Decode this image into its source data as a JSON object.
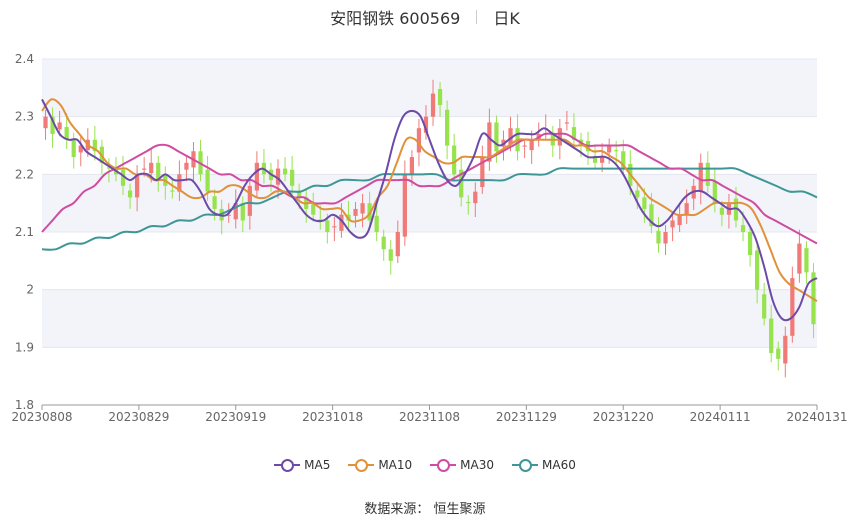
{
  "header": {
    "title": "安阳钢铁 600569",
    "period": "日K"
  },
  "source": "数据来源： 恒生聚源",
  "chart_data": {
    "type": "candlestick",
    "ylim": [
      1.8,
      2.4
    ],
    "yticks": [
      "1.8",
      "1.9",
      "2",
      "2.1",
      "2.2",
      "2.3",
      "2.4"
    ],
    "xticks": [
      "20230808",
      "20230829",
      "20230919",
      "20231018",
      "20231108",
      "20231129",
      "20231220",
      "20240111",
      "20240131"
    ],
    "colors": {
      "up": "#f07a78",
      "down": "#97e34e",
      "MA5": "#6c4aa8",
      "MA10": "#e0913a",
      "MA30": "#cf4ca0",
      "MA60": "#3f9696"
    },
    "legend": [
      {
        "name": "MA5",
        "color": "#6c4aa8"
      },
      {
        "name": "MA10",
        "color": "#e0913a"
      },
      {
        "name": "MA30",
        "color": "#cf4ca0"
      },
      {
        "name": "MA60",
        "color": "#3f9696"
      }
    ],
    "closes": [
      2.3,
      2.27,
      2.29,
      2.26,
      2.23,
      2.25,
      2.26,
      2.24,
      2.22,
      2.21,
      2.2,
      2.18,
      2.16,
      2.2,
      2.21,
      2.22,
      2.19,
      2.18,
      2.17,
      2.2,
      2.22,
      2.24,
      2.2,
      2.17,
      2.14,
      2.12,
      2.13,
      2.15,
      2.12,
      2.18,
      2.22,
      2.2,
      2.19,
      2.21,
      2.2,
      2.18,
      2.16,
      2.14,
      2.13,
      2.12,
      2.1,
      2.11,
      2.13,
      2.12,
      2.14,
      2.15,
      2.12,
      2.1,
      2.07,
      2.05,
      2.1,
      2.2,
      2.23,
      2.28,
      2.3,
      2.34,
      2.32,
      2.25,
      2.2,
      2.16,
      2.15,
      2.17,
      2.23,
      2.29,
      2.24,
      2.26,
      2.28,
      2.24,
      2.25,
      2.26,
      2.27,
      2.28,
      2.25,
      2.28,
      2.29,
      2.26,
      2.25,
      2.24,
      2.22,
      2.23,
      2.25,
      2.24,
      2.21,
      2.18,
      2.16,
      2.14,
      2.11,
      2.08,
      2.1,
      2.12,
      2.13,
      2.15,
      2.18,
      2.22,
      2.18,
      2.15,
      2.13,
      2.15,
      2.12,
      2.1,
      2.06,
      2.0,
      1.95,
      1.89,
      1.88,
      1.92,
      2.02,
      2.08,
      2.03,
      1.94
    ],
    "ma5": [
      2.33,
      2.3,
      2.27,
      2.26,
      2.26,
      2.24,
      2.23,
      2.22,
      2.21,
      2.2,
      2.19,
      2.2,
      2.2,
      2.19,
      2.2,
      2.19,
      2.19,
      2.19,
      2.17,
      2.14,
      2.13,
      2.13,
      2.15,
      2.18,
      2.2,
      2.21,
      2.2,
      2.19,
      2.17,
      2.15,
      2.13,
      2.12,
      2.12,
      2.13,
      2.12,
      2.1,
      2.09,
      2.1,
      2.15,
      2.2,
      2.26,
      2.3,
      2.31,
      2.3,
      2.26,
      2.22,
      2.19,
      2.18,
      2.2,
      2.23,
      2.27,
      2.26,
      2.25,
      2.26,
      2.27,
      2.27,
      2.27,
      2.28,
      2.27,
      2.26,
      2.25,
      2.24,
      2.23,
      2.23,
      2.23,
      2.22,
      2.2,
      2.17,
      2.14,
      2.12,
      2.11,
      2.12,
      2.14,
      2.16,
      2.17,
      2.17,
      2.16,
      2.15,
      2.14,
      2.14,
      2.12,
      2.09,
      2.04,
      1.98,
      1.95,
      1.95,
      1.97,
      2.01,
      2.02
    ],
    "ma10": [
      2.31,
      2.33,
      2.32,
      2.29,
      2.27,
      2.25,
      2.24,
      2.22,
      2.21,
      2.21,
      2.2,
      2.2,
      2.19,
      2.19,
      2.18,
      2.17,
      2.16,
      2.16,
      2.17,
      2.17,
      2.18,
      2.18,
      2.17,
      2.16,
      2.16,
      2.17,
      2.17,
      2.16,
      2.15,
      2.15,
      2.14,
      2.14,
      2.14,
      2.12,
      2.12,
      2.13,
      2.16,
      2.18,
      2.22,
      2.26,
      2.26,
      2.24,
      2.23,
      2.22,
      2.22,
      2.23,
      2.23,
      2.23,
      2.23,
      2.24,
      2.25,
      2.26,
      2.26,
      2.26,
      2.26,
      2.26,
      2.26,
      2.25,
      2.25,
      2.24,
      2.24,
      2.23,
      2.22,
      2.2,
      2.18,
      2.16,
      2.15,
      2.14,
      2.13,
      2.13,
      2.13,
      2.14,
      2.15,
      2.15,
      2.15,
      2.15,
      2.14,
      2.11,
      2.07,
      2.03,
      2.01,
      2.0,
      1.99,
      1.98
    ],
    "ma30": [
      2.1,
      2.12,
      2.14,
      2.15,
      2.17,
      2.18,
      2.2,
      2.21,
      2.22,
      2.23,
      2.24,
      2.25,
      2.25,
      2.24,
      2.23,
      2.22,
      2.21,
      2.2,
      2.2,
      2.19,
      2.19,
      2.18,
      2.18,
      2.17,
      2.16,
      2.16,
      2.15,
      2.15,
      2.15,
      2.16,
      2.17,
      2.18,
      2.19,
      2.19,
      2.19,
      2.19,
      2.18,
      2.18,
      2.18,
      2.19,
      2.2,
      2.21,
      2.22,
      2.23,
      2.24,
      2.25,
      2.26,
      2.26,
      2.27,
      2.27,
      2.27,
      2.26,
      2.25,
      2.25,
      2.25,
      2.25,
      2.25,
      2.24,
      2.23,
      2.22,
      2.21,
      2.21,
      2.2,
      2.19,
      2.19,
      2.18,
      2.17,
      2.16,
      2.15,
      2.13,
      2.12,
      2.11,
      2.1,
      2.09,
      2.08
    ],
    "ma60": [
      2.07,
      2.07,
      2.08,
      2.08,
      2.09,
      2.09,
      2.1,
      2.1,
      2.11,
      2.11,
      2.12,
      2.12,
      2.13,
      2.13,
      2.14,
      2.15,
      2.15,
      2.16,
      2.17,
      2.17,
      2.18,
      2.18,
      2.19,
      2.19,
      2.19,
      2.2,
      2.2,
      2.2,
      2.2,
      2.2,
      2.19,
      2.19,
      2.19,
      2.19,
      2.19,
      2.2,
      2.2,
      2.2,
      2.21,
      2.21,
      2.21,
      2.21,
      2.21,
      2.21,
      2.21,
      2.21,
      2.21,
      2.21,
      2.21,
      2.21,
      2.21,
      2.21,
      2.2,
      2.19,
      2.18,
      2.17,
      2.17,
      2.16
    ]
  }
}
